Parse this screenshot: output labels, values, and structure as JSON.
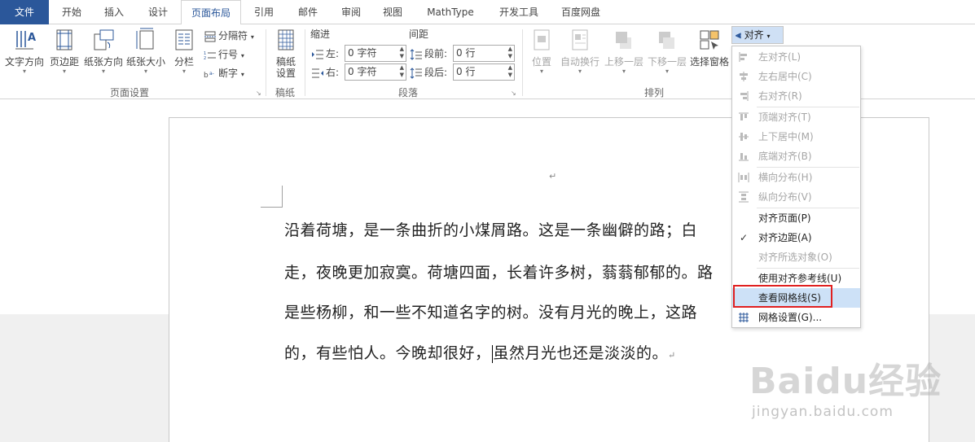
{
  "tabs": [
    "文件",
    "开始",
    "插入",
    "设计",
    "页面布局",
    "引用",
    "邮件",
    "审阅",
    "视图",
    "MathType",
    "开发工具",
    "百度网盘"
  ],
  "active_tab_index": 4,
  "ribbon": {
    "page_setup": {
      "text_direction": "文字方向",
      "margins": "页边距",
      "orientation": "纸张方向",
      "size": "纸张大小",
      "columns": "分栏",
      "breaks": "分隔符",
      "line_numbers": "行号",
      "hyphenation": "断字",
      "group_label": "页面设置"
    },
    "manuscript": {
      "btn_line1": "稿纸",
      "btn_line2": "设置",
      "group_label": "稿纸"
    },
    "paragraph": {
      "indent_title": "缩进",
      "spacing_title": "间距",
      "left_label": "左:",
      "right_label": "右:",
      "before_label": "段前:",
      "after_label": "段后:",
      "left_value": "0 字符",
      "right_value": "0 字符",
      "before_value": "0 行",
      "after_value": "0 行",
      "group_label": "段落"
    },
    "arrange": {
      "position": "位置",
      "wrap_text": "自动换行",
      "bring_forward": "上移一层",
      "send_backward": "下移一层",
      "selection_pane": "选择窗格",
      "align": "对齐",
      "group_label": "排列"
    }
  },
  "align_menu": {
    "items": [
      {
        "label": "左对齐(L)",
        "icon": "align-left-icon",
        "disabled": true
      },
      {
        "label": "左右居中(C)",
        "icon": "align-center-icon",
        "disabled": true
      },
      {
        "label": "右对齐(R)",
        "icon": "align-right-icon",
        "disabled": true
      },
      {
        "label": "顶端对齐(T)",
        "icon": "align-top-icon",
        "disabled": true
      },
      {
        "label": "上下居中(M)",
        "icon": "align-middle-icon",
        "disabled": true
      },
      {
        "label": "底端对齐(B)",
        "icon": "align-bottom-icon",
        "disabled": true
      },
      {
        "label": "横向分布(H)",
        "icon": "distribute-horizontal-icon",
        "disabled": true
      },
      {
        "label": "纵向分布(V)",
        "icon": "distribute-vertical-icon",
        "disabled": true
      },
      {
        "label": "对齐页面(P)",
        "icon": "",
        "disabled": false
      },
      {
        "label": "对齐边距(A)",
        "icon": "checkmark-icon",
        "disabled": false
      },
      {
        "label": "对齐所选对象(O)",
        "icon": "",
        "disabled": true
      },
      {
        "label": "使用对齐参考线(U)",
        "icon": "",
        "disabled": false
      },
      {
        "label": "查看网格线(S)",
        "icon": "",
        "disabled": false
      },
      {
        "label": "网格设置(G)...",
        "icon": "grid-icon",
        "disabled": false
      }
    ]
  },
  "document": {
    "lines": [
      "沿着荷塘，是一条曲折的小煤屑路。这是一条幽僻的路；白",
      "走，夜晚更加寂寞。荷塘四面，长着许多树，蓊蓊郁郁的。路",
      "是些杨柳，和一些不知道名字的树。没有月光的晚上，这路",
      "的，有些怕人。今晚却很好，"
    ],
    "line4_after_caret": "虽然月光也还是淡淡的。",
    "para_mark": "↵"
  },
  "watermark": {
    "logo_text": "Baidu经验",
    "url": "jingyan.baidu.com"
  },
  "colors": {
    "file_tab": "#2b579a",
    "highlight": "#cde1f7",
    "red_box": "#e02020"
  }
}
